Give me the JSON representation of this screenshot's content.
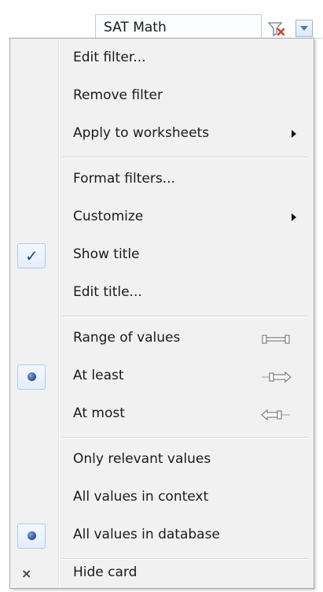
{
  "card": {
    "title": "SAT Math",
    "clear_filter_icon": "filter-clear-icon",
    "dropdown_icon": "chevron-down-icon"
  },
  "menu": {
    "groups": [
      {
        "items": [
          {
            "label": "Edit filter..."
          },
          {
            "label": "Remove filter"
          },
          {
            "label": "Apply to worksheets",
            "submenu": true
          }
        ]
      },
      {
        "items": [
          {
            "label": "Format filters..."
          },
          {
            "label": "Customize",
            "submenu": true
          },
          {
            "label": "Show title",
            "checked": true
          },
          {
            "label": "Edit title..."
          }
        ]
      },
      {
        "items": [
          {
            "label": "Range of values",
            "icon": "range-both-icon"
          },
          {
            "label": "At least",
            "selected": true,
            "icon": "range-at-least-icon"
          },
          {
            "label": "At most",
            "icon": "range-at-most-icon"
          }
        ]
      },
      {
        "items": [
          {
            "label": "Only relevant values"
          },
          {
            "label": "All values in context"
          },
          {
            "label": "All values in database",
            "selected": true
          }
        ]
      },
      {
        "items": [
          {
            "label": "Hide card",
            "icon": "close-icon"
          }
        ]
      }
    ]
  },
  "colors": {
    "menu_background": "#f1f1f1",
    "check_accent": "#20488a",
    "radio_accent": "#3d5aa5"
  }
}
